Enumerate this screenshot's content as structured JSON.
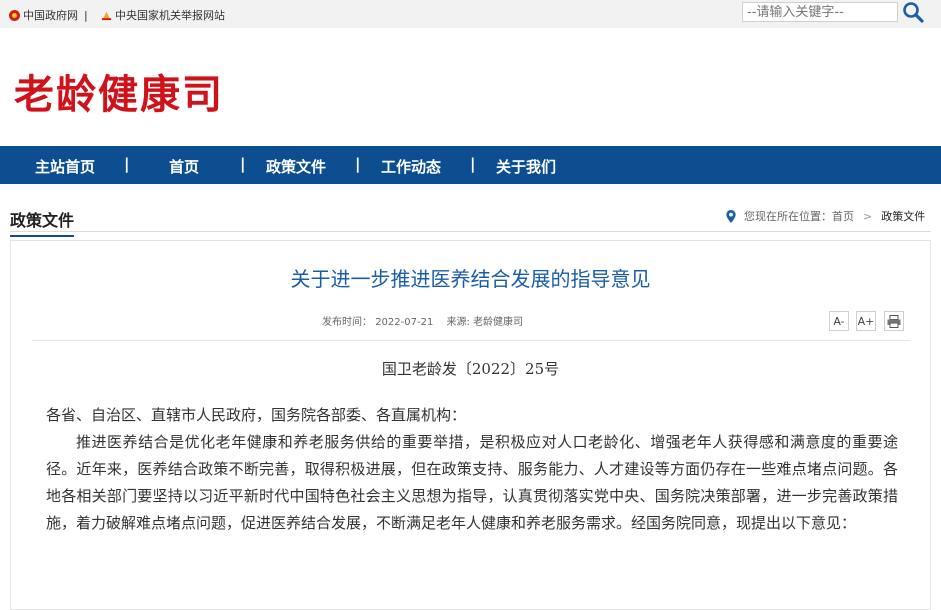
{
  "topbar": {
    "gov_link": "中国政府网",
    "divider": "|",
    "report_link": "中央国家机关举报网站",
    "search_placeholder": "--请输入关键字--"
  },
  "header": {
    "site_title": "老龄健康司"
  },
  "nav": {
    "items": [
      "主站首页",
      "首页",
      "政策文件",
      "工作动态",
      "关于我们"
    ],
    "separator": "|"
  },
  "section": {
    "title": "政策文件"
  },
  "breadcrumb": {
    "prefix": "您现在所在位置：",
    "home": "首页",
    "separator": ">",
    "current": "政策文件"
  },
  "article": {
    "title": "关于进一步推进医养结合发展的指导意见",
    "publish_label": "发布时间：",
    "publish_date": "2022-07-21",
    "source_label": "来源:",
    "source": "老龄健康司",
    "font_smaller": "A-",
    "font_larger": "A+",
    "doc_number": "国卫老龄发〔2022〕25号",
    "salutation": "各省、自治区、直辖市人民政府，国务院各部委、各直属机构：",
    "paragraph_1": "推进医养结合是优化老年健康和养老服务供给的重要举措，是积极应对人口老龄化、增强老年人获得感和满意度的重要途径。近年来，医养结合政策不断完善，取得积极进展，但在政策支持、服务能力、人才建设等方面仍存在一些难点堵点问题。各地各相关部门要坚持以习近平新时代中国特色社会主义思想为指导，认真贯彻落实党中央、国务院决策部署，进一步完善政策措施，着力破解难点堵点问题，促进医养结合发展，不断满足老年人健康和养老服务需求。经国务院同意，现提出以下意见："
  },
  "colors": {
    "brand_red": "#d0121b",
    "nav_blue": "#0c4e8f",
    "title_blue": "#1a5ea8"
  },
  "icons": [
    "emblem-icon",
    "report-icon",
    "search-icon",
    "location-pin-icon",
    "print-icon"
  ]
}
